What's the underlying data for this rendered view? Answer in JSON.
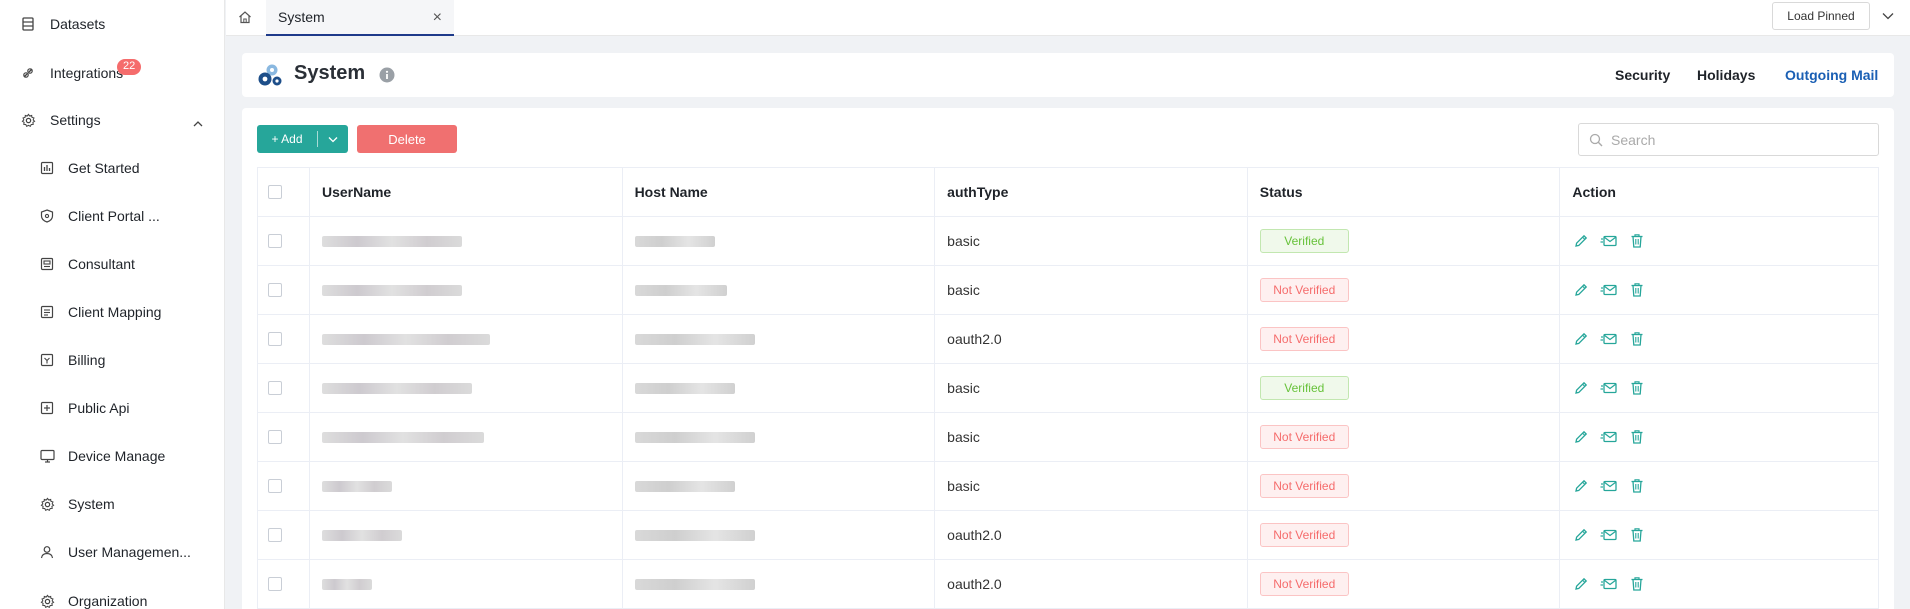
{
  "sidebar": {
    "items": [
      {
        "label": "Datasets",
        "icon": "dataset-icon",
        "level": 1
      },
      {
        "label": "Integrations",
        "icon": "integrations-icon",
        "level": 1,
        "badge": "22"
      },
      {
        "label": "Settings",
        "icon": "settings-icon",
        "level": 1,
        "expanded": true
      },
      {
        "label": "Get Started",
        "icon": "get-started-icon",
        "level": 2
      },
      {
        "label": "Client Portal ...",
        "icon": "client-portal-icon",
        "level": 2
      },
      {
        "label": "Consultant",
        "icon": "consultant-icon",
        "level": 2
      },
      {
        "label": "Client Mapping",
        "icon": "client-mapping-icon",
        "level": 2
      },
      {
        "label": "Billing",
        "icon": "billing-icon",
        "level": 2
      },
      {
        "label": "Public Api",
        "icon": "public-api-icon",
        "level": 2
      },
      {
        "label": "Device Manage",
        "icon": "device-manage-icon",
        "level": 2
      },
      {
        "label": "System",
        "icon": "system-icon",
        "level": 2
      },
      {
        "label": "User Managemen...",
        "icon": "user-management-icon",
        "level": 2
      },
      {
        "label": "Organization",
        "icon": "organization-icon",
        "level": 2
      }
    ]
  },
  "tabbar": {
    "active_tab": "System",
    "load_pinned_label": "Load Pinned"
  },
  "header": {
    "title": "System",
    "nav": [
      "Security",
      "Holidays",
      "Outgoing Mail"
    ],
    "active_nav": "Outgoing Mail"
  },
  "toolbar": {
    "add_label": "+ Add",
    "delete_label": "Delete",
    "search_placeholder": "Search"
  },
  "table": {
    "columns": [
      "UserName",
      "Host Name",
      "authType",
      "Status",
      "Action"
    ],
    "rows": [
      {
        "auth": "basic",
        "status": "Verified"
      },
      {
        "auth": "basic",
        "status": "Not Verified"
      },
      {
        "auth": "oauth2.0",
        "status": "Not Verified"
      },
      {
        "auth": "basic",
        "status": "Verified"
      },
      {
        "auth": "basic",
        "status": "Not Verified"
      },
      {
        "auth": "basic",
        "status": "Not Verified"
      },
      {
        "auth": "oauth2.0",
        "status": "Not Verified"
      },
      {
        "auth": "oauth2.0",
        "status": "Not Verified"
      }
    ]
  },
  "colors": {
    "accent": "#26a69a",
    "danger": "#f07070",
    "link_active": "#1a5fb4",
    "verified": "#67c23a",
    "not_verified": "#f56c6c"
  }
}
